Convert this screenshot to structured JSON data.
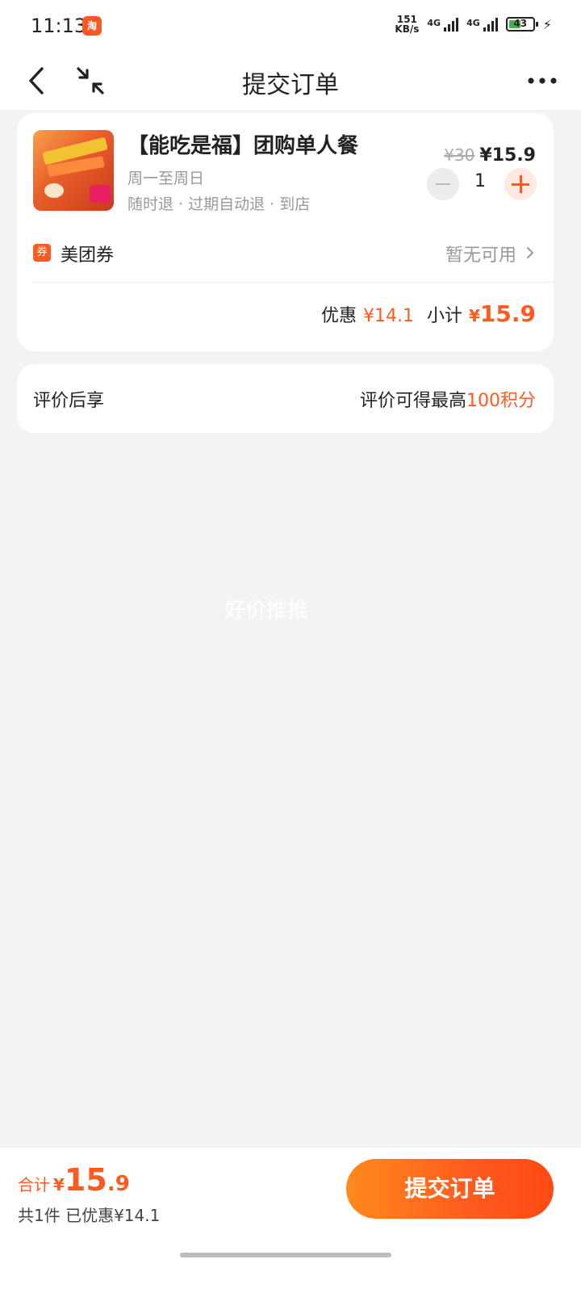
{
  "status_bar": {
    "time": "11:13",
    "app_icon_text": "淘",
    "net_speed_value": "151",
    "net_speed_unit": "KB/s",
    "sim1": "4G",
    "sim2": "4G",
    "battery": "43"
  },
  "nav": {
    "title": "提交订单",
    "back_icon": "back-arrow-icon",
    "shrink_icon": "minimize-icon",
    "more_icon": "more-dots-icon"
  },
  "product": {
    "title": "【能吃是福】团购单人餐",
    "usage_days": "周一至周日",
    "policy": "随时退 · 过期自动退 · 到店",
    "original_price": "¥30",
    "price": "¥15.9",
    "quantity": "1"
  },
  "coupon": {
    "badge": "券",
    "label": "美团券",
    "status": "暂无可用"
  },
  "subtotal": {
    "discount_label": "优惠",
    "discount_value": "¥14.1",
    "label": "小计",
    "currency": "¥",
    "value": "15.9"
  },
  "review": {
    "label": "评价后享",
    "reward_prefix": "评价可得最高",
    "reward_highlight": "100积分"
  },
  "watermark": "好价推推",
  "footer": {
    "total_label": "合计",
    "currency": "¥",
    "total_int": "15",
    "total_dec": ".9",
    "summary": "共1件  已优惠¥14.1",
    "submit_label": "提交订单"
  },
  "colors": {
    "accent": "#ff5a1f",
    "button_gradient_start": "#ff8a1c",
    "page_bg": "#f3f3f3"
  }
}
